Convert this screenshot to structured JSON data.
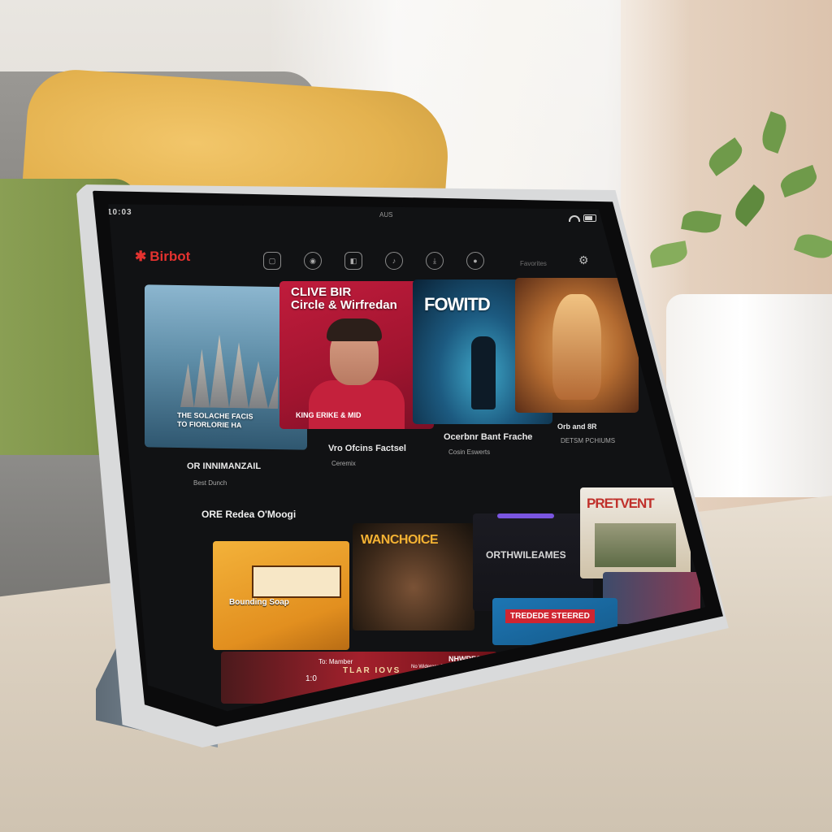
{
  "status_bar": {
    "time": "10:03",
    "center": "AUS"
  },
  "app": {
    "logo": "Birbot"
  },
  "nav": {
    "search_label": "Favorites"
  },
  "featured": [
    {
      "poster_title": "THE SOLACHE FACIS\nTO FIORLORIE HA",
      "caption": "OR INNIMANZAIL",
      "sub": "Best Dunch"
    },
    {
      "poster_title": "CLIVE BIR\nCircle & Wirfredan",
      "poster_sub": "KING ERIKE & MID",
      "caption": "Vro Ofcins Factsel",
      "sub": "Ceremix"
    },
    {
      "poster_title": "FOWITD",
      "caption": "Ocerbnr Bant Frache",
      "sub": "Cosin Eswerts"
    },
    {
      "poster_title": "",
      "caption": "Orb and 8R",
      "sub": "DETSM PCHIUMS"
    }
  ],
  "row": {
    "title": "ORE Redea O'Moogi",
    "tiles": [
      {
        "title": "Bounding Soap"
      },
      {
        "title": "WANCHOICE"
      },
      {
        "title": "ORTHWILEAMES"
      },
      {
        "title": "PRETVENT"
      },
      {
        "title": ""
      },
      {
        "title": "TREDEDE STEERED"
      },
      {
        "title": "TLAR IOVS",
        "small": "To: Mamber",
        "tv": "NHWRESO",
        "tvd": "No Widerons Fonser Thegers",
        "dots": "1:0"
      }
    ]
  },
  "colors": {
    "accent": "#e3322f",
    "screen_bg": "#111214"
  }
}
